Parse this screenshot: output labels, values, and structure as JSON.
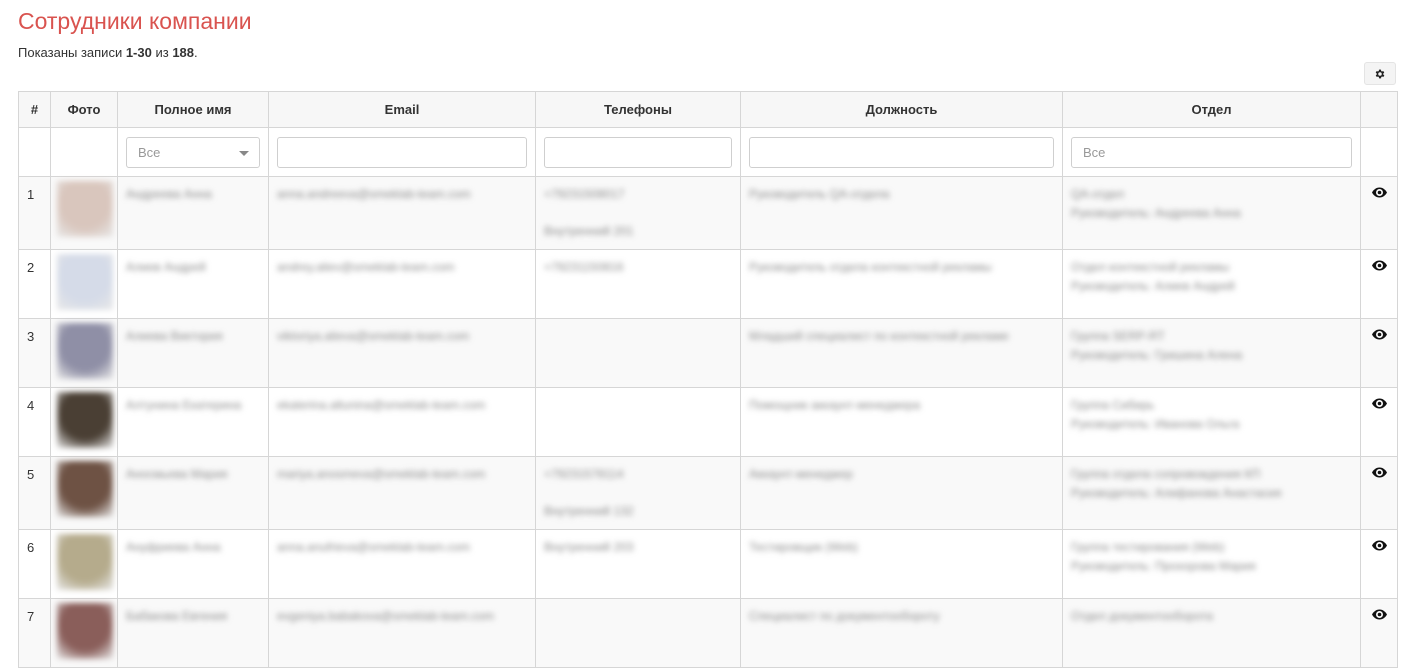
{
  "page": {
    "title": "Сотрудники компании",
    "summary_prefix": "Показаны записи ",
    "summary_range": "1-30",
    "summary_mid": " из ",
    "summary_total": "188",
    "summary_suffix": "."
  },
  "toolbar": {
    "settings_icon": "gear-icon"
  },
  "table": {
    "columns": [
      "#",
      "Фото",
      "Полное имя",
      "Email",
      "Телефоны",
      "Должность",
      "Отдел"
    ],
    "filters": {
      "name_select": "Все",
      "department_placeholder": "Все"
    },
    "rows": [
      {
        "num": "1",
        "name": "Андреева Анна",
        "email": "anna.andreeva@smeklab-team.com",
        "phone": "+79231508017",
        "phone_ext": "Внутренний 201",
        "position": "Руководитель QA-отдела",
        "dept": "QA-отдел",
        "dept_head": "Руководитель: Андреева Анна",
        "photo_color": "#d9c6bd"
      },
      {
        "num": "2",
        "name": "Алиев Андрей",
        "email": "andrey.aliev@smeklab-team.com",
        "phone": "+79231150816",
        "phone_ext": "",
        "position": "Руководитель отдела контекстной рекламы",
        "dept": "Отдел контекстной рекламы",
        "dept_head": "Руководитель: Алиев Андрей",
        "photo_color": "#d5dbe8"
      },
      {
        "num": "3",
        "name": "Алиева Виктория",
        "email": "viktoriya.alieva@smeklab-team.com",
        "phone": "",
        "phone_ext": "",
        "position": "Младший специалист по контекстной рекламе",
        "dept": "Группа SERP-RT",
        "dept_head": "Руководитель: Гришина Алена",
        "photo_color": "#8f8fa6"
      },
      {
        "num": "4",
        "name": "Алтунина Екатерина",
        "email": "ekaterina.altunina@smeklab-team.com",
        "phone": "",
        "phone_ext": "",
        "position": "Помощник аккаунт-менеджера",
        "dept": "Группа Сибирь",
        "dept_head": "Руководитель: Иванова Ольга",
        "photo_color": "#4a3f34"
      },
      {
        "num": "5",
        "name": "Аносмьева Мария",
        "email": "mariya.anosmeva@smeklab-team.com",
        "phone": "+79231578114",
        "phone_ext": "Внутренний 132",
        "position": "Аккаунт-менеджер",
        "dept": "Группа отдела сопровождения КП",
        "dept_head": "Руководитель: Алифанова Анастасия",
        "photo_color": "#6e5244"
      },
      {
        "num": "6",
        "name": "Ануфриева Анна",
        "email": "anna.anufrieva@smeklab-team.com",
        "phone": "Внутренний 203",
        "phone_ext": "",
        "position": "Тестировщик (Web)",
        "dept": "Группа тестирования (Web)",
        "dept_head": "Руководитель: Прохорова Мария",
        "photo_color": "#b5ab8c"
      },
      {
        "num": "7",
        "name": "Бабакова Евгения",
        "email": "evgeniya.babakova@smeklab-team.com",
        "phone": "",
        "phone_ext": "",
        "position": "Специалист по документообороту",
        "dept": "Отдел документооборота",
        "dept_head": "",
        "photo_color": "#8a5e5a"
      }
    ]
  }
}
